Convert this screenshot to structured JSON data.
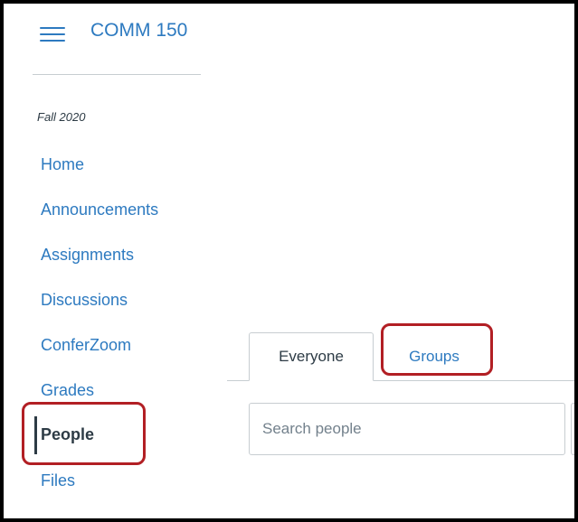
{
  "header": {
    "course_title": "COMM 150"
  },
  "sidebar": {
    "term": "Fall 2020",
    "items": [
      {
        "label": "Home"
      },
      {
        "label": "Announcements"
      },
      {
        "label": "Assignments"
      },
      {
        "label": "Discussions"
      },
      {
        "label": "ConferZoom"
      },
      {
        "label": "Grades"
      },
      {
        "label": "People",
        "active": true
      },
      {
        "label": "Files"
      }
    ]
  },
  "main": {
    "tabs": [
      {
        "label": "Everyone",
        "selected": true
      },
      {
        "label": "Groups",
        "selected": false
      }
    ],
    "search": {
      "placeholder": "Search people",
      "value": ""
    }
  },
  "colors": {
    "link": "#2d7ac0",
    "text": "#2d3b45",
    "border": "#c7cdd1",
    "annotation": "#b21f24"
  },
  "icons": {
    "menu": "hamburger-menu-icon"
  }
}
